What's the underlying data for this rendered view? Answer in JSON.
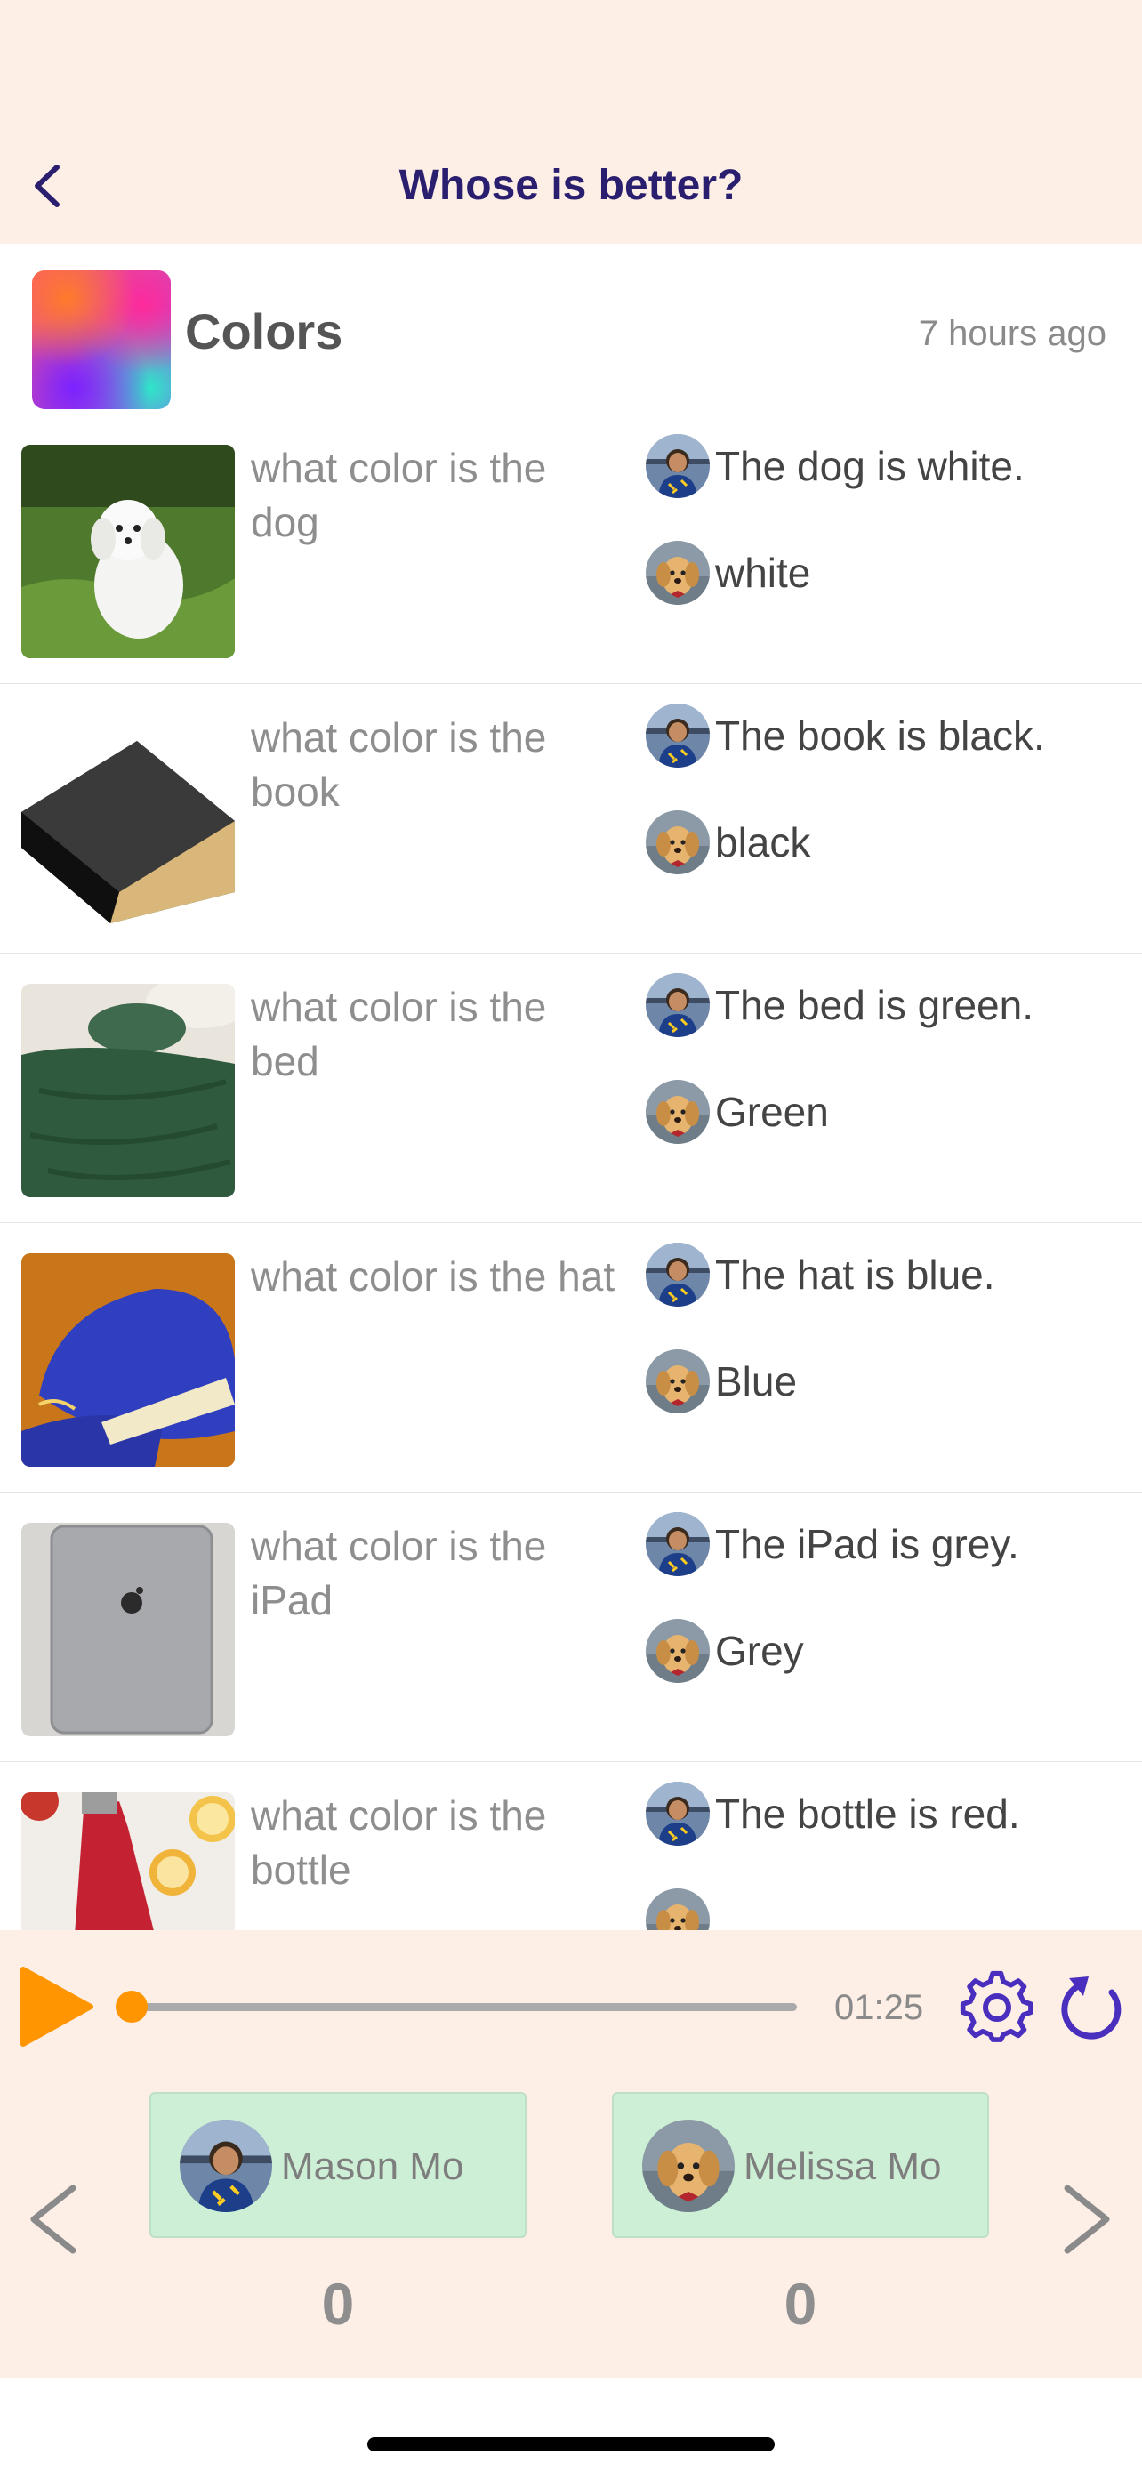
{
  "header": {
    "title": "Whose is better?"
  },
  "lesson": {
    "title": "Colors",
    "time_ago": "7 hours ago"
  },
  "rows": [
    {
      "question": "what color is the dog",
      "image": "white-dog-photo",
      "answers": [
        "The dog is white.",
        "white"
      ]
    },
    {
      "question": "what color is the book",
      "image": "black-book-photo",
      "answers": [
        "The book is black.",
        "black"
      ]
    },
    {
      "question": "what color is the bed",
      "image": "green-bed-photo",
      "answers": [
        "The bed is green.",
        "Green"
      ]
    },
    {
      "question": "what color is the hat",
      "image": "blue-hat-photo",
      "answers": [
        "The hat is blue.",
        "Blue"
      ]
    },
    {
      "question": "what color is the iPad",
      "image": "grey-ipad-photo",
      "answers": [
        "The iPad is grey.",
        "Grey"
      ]
    },
    {
      "question": "what color is the bottle",
      "image": "red-bottle-photo",
      "answers": [
        "The bottle is red.",
        ""
      ]
    }
  ],
  "player": {
    "time": "01:25",
    "progress": 0.01
  },
  "players": [
    {
      "name": "Mason Mo",
      "score": "0",
      "avatar": "boy-avatar"
    },
    {
      "name": "Melissa Mo",
      "score": "0",
      "avatar": "puppy-avatar"
    }
  ],
  "colors": {
    "accent": "#ff9500",
    "brand": "#2a1f6e",
    "icon_purple": "#4a2fbf",
    "card_green": "#cdefd5",
    "background": "#fdeee6"
  }
}
